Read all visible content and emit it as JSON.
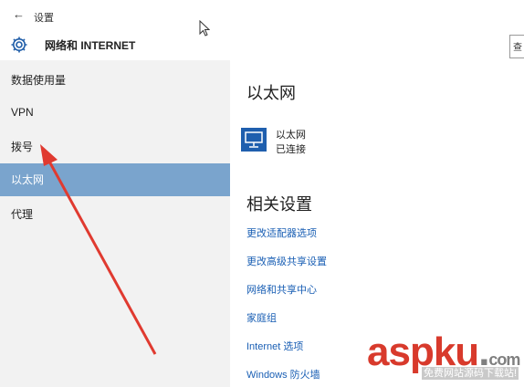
{
  "header": {
    "back_glyph": "←",
    "app_title": "设置",
    "section_icon": "gear-icon",
    "section_title": "网络和 INTERNET",
    "right_button_glyph": "查"
  },
  "sidebar": {
    "items": [
      {
        "label": "数据使用量",
        "selected": false
      },
      {
        "label": "VPN",
        "selected": false
      },
      {
        "label": "拨号",
        "selected": false
      },
      {
        "label": "以太网",
        "selected": true
      },
      {
        "label": "代理",
        "selected": false
      }
    ],
    "selected_color": "#7aa4cd"
  },
  "main": {
    "title": "以太网",
    "connection": {
      "icon": "ethernet-monitor-icon",
      "name": "以太网",
      "status": "已连接"
    },
    "related_title": "相关设置",
    "links": [
      "更改适配器选项",
      "更改高级共享设置",
      "网络和共享中心",
      "家庭组",
      "Internet 选项",
      "Windows 防火墙"
    ],
    "link_color": "#1a5fb4"
  },
  "annotation": {
    "arrow_color": "#e03a30"
  },
  "watermark": {
    "main": "asp",
    "highlight": "ku",
    "dot": ".",
    "suffix": "com",
    "sub": "免费网站源码下载站!"
  }
}
